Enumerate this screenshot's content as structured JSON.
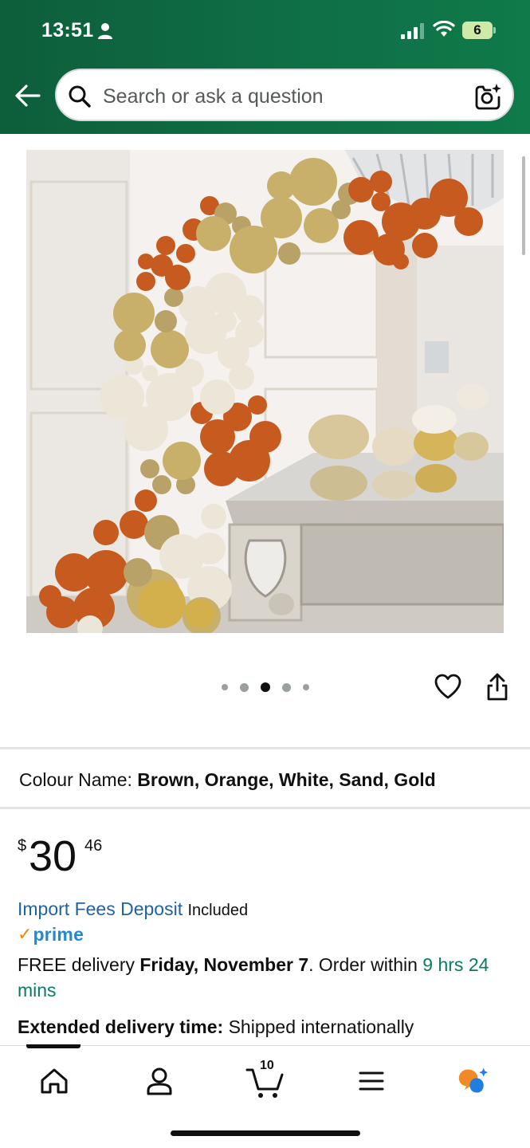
{
  "status_bar": {
    "time": "13:51",
    "battery": "6"
  },
  "search": {
    "placeholder": "Search or ask a question"
  },
  "product": {
    "image_alt": "Balloon garland arch decoration",
    "carousel": {
      "total": 5,
      "active_index": 2
    }
  },
  "variation": {
    "label": "Colour Name:",
    "value": "Brown, Orange, White, Sand, Gold"
  },
  "price": {
    "symbol": "$",
    "whole": "30",
    "fraction": "46"
  },
  "import_fees": {
    "link": "Import Fees Deposit",
    "status": "Included"
  },
  "prime": {
    "check": "✓",
    "label": "prime"
  },
  "delivery": {
    "prefix": "FREE delivery",
    "date": "Friday, November 7",
    "middle": ". Order within",
    "window": "9 hrs 24 mins"
  },
  "extended": {
    "label": "Extended delivery time:",
    "value": "Shipped internationally"
  },
  "bottom_nav": {
    "cart_count": "10"
  },
  "colors": {
    "header_green": "#0f6d44",
    "link_blue": "#2162a1",
    "teal": "#067d62",
    "prime_orange": "#f08804"
  }
}
